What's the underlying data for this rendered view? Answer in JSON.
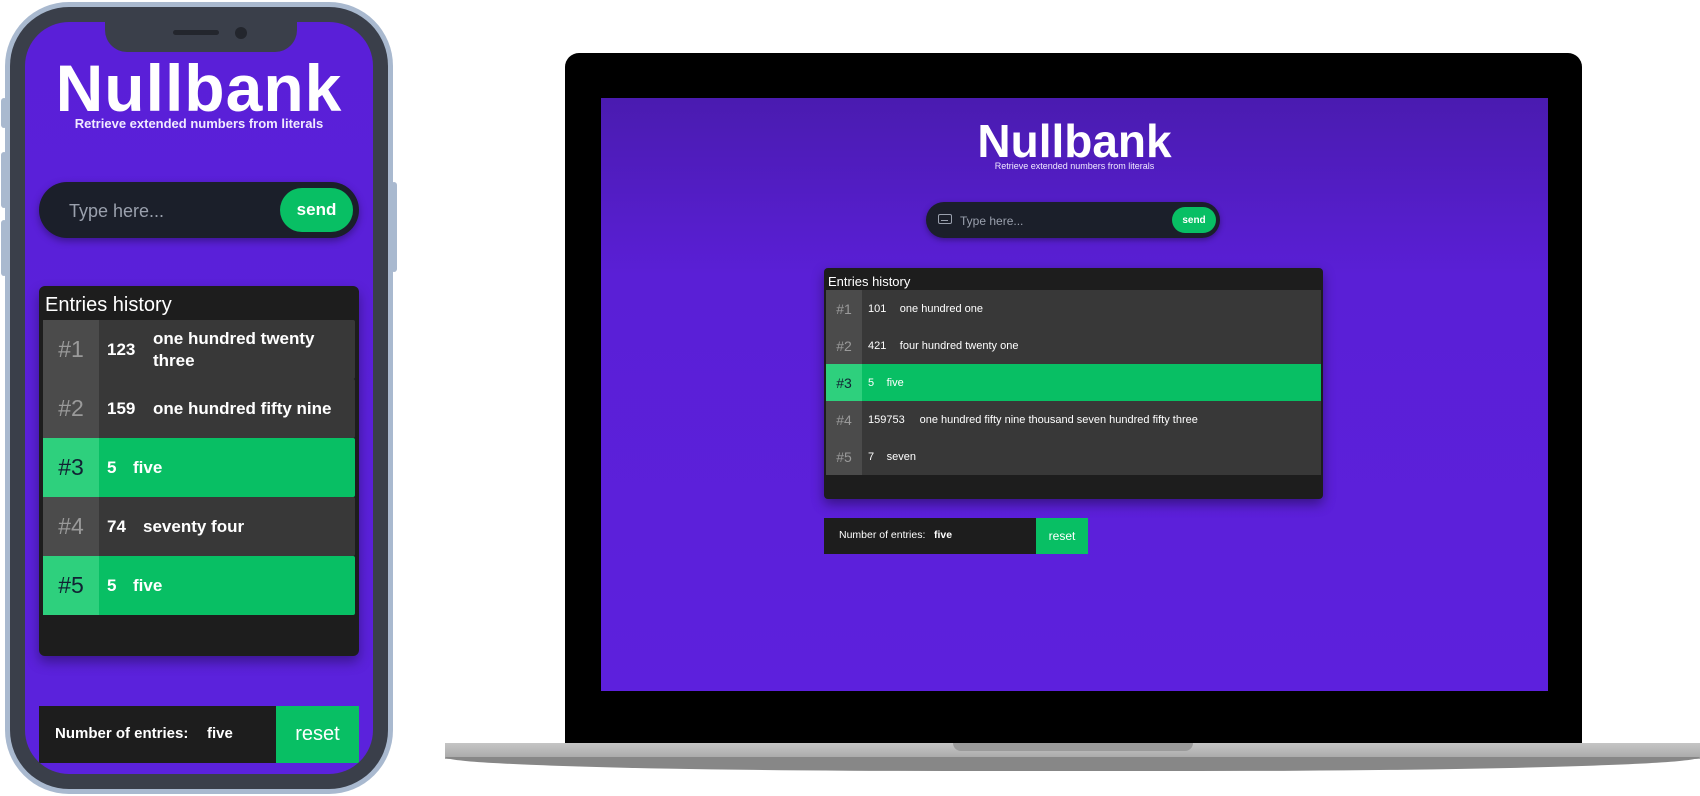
{
  "app": {
    "title": "Nullbank",
    "subtitle": "Retrieve extended numbers from literals"
  },
  "search": {
    "placeholder": "Type here...",
    "value": "",
    "send_label": "send",
    "keyboard_icon": "keyboard-icon"
  },
  "history_title": "Entries history",
  "footer": {
    "count_label": "Number of entries:",
    "reset_label": "reset"
  },
  "mobile": {
    "entry_count": "five",
    "entries": [
      {
        "index": "#1",
        "number": "123",
        "words": "one hundred twenty three",
        "active": false
      },
      {
        "index": "#2",
        "number": "159",
        "words": "one hundred fifty nine",
        "active": false
      },
      {
        "index": "#3",
        "number": "5",
        "words": "five",
        "active": true
      },
      {
        "index": "#4",
        "number": "74",
        "words": "seventy four",
        "active": false
      },
      {
        "index": "#5",
        "number": "5",
        "words": "five",
        "active": true
      }
    ]
  },
  "desktop": {
    "entry_count": "five",
    "entries": [
      {
        "index": "#1",
        "number": "101",
        "words": "one hundred one",
        "active": false
      },
      {
        "index": "#2",
        "number": "421",
        "words": "four hundred twenty one",
        "active": false
      },
      {
        "index": "#3",
        "number": "5",
        "words": "five",
        "active": true
      },
      {
        "index": "#4",
        "number": "159753",
        "words": "one hundred fifty nine thousand seven hundred fifty three",
        "active": false
      },
      {
        "index": "#5",
        "number": "7",
        "words": "seven",
        "active": false
      }
    ]
  },
  "colors": {
    "background_purple": "#5b22dc",
    "accent_green": "#08bf64",
    "panel_dark": "#1d1d1d",
    "row_gray": "#383838"
  }
}
